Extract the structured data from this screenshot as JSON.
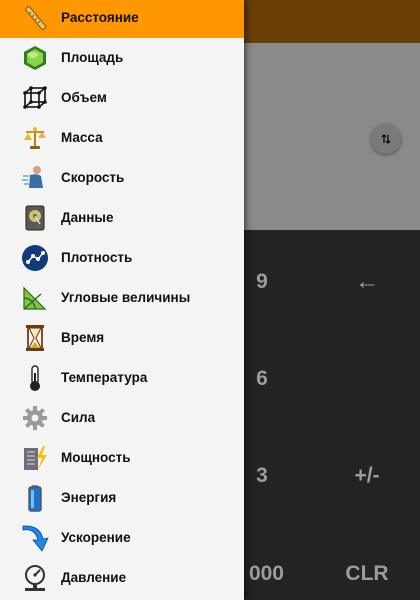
{
  "colors": {
    "accent": "#ff9800",
    "appbar": "#6a3f06",
    "display": "#8a8a8a",
    "keypad": "#232323",
    "drawer_bg": "#f4f4f4",
    "key_text": "#9c9c9c"
  },
  "drawer": {
    "selected": "Расстояние",
    "items": [
      {
        "label": "Расстояние",
        "icon": "ruler-icon"
      },
      {
        "label": "Площадь",
        "icon": "area-hexagon-icon"
      },
      {
        "label": "Объем",
        "icon": "volume-cube-icon"
      },
      {
        "label": "Масса",
        "icon": "scales-icon"
      },
      {
        "label": "Скорость",
        "icon": "runner-icon"
      },
      {
        "label": "Данные",
        "icon": "hard-drive-icon"
      },
      {
        "label": "Плотность",
        "icon": "density-molecule-icon"
      },
      {
        "label": "Угловые величины",
        "icon": "protractor-icon"
      },
      {
        "label": "Время",
        "icon": "hourglass-icon"
      },
      {
        "label": "Температура",
        "icon": "thermometer-icon"
      },
      {
        "label": "Сила",
        "icon": "gear-icon"
      },
      {
        "label": "Мощность",
        "icon": "power-lightning-icon"
      },
      {
        "label": "Энергия",
        "icon": "battery-icon"
      },
      {
        "label": "Ускорение",
        "icon": "curved-arrow-icon"
      },
      {
        "label": "Давление",
        "icon": "pressure-gauge-icon"
      }
    ]
  },
  "swap_button": {
    "icon": "swap-vertical-icon"
  },
  "keypad": {
    "keys": [
      {
        "label": "9"
      },
      {
        "label": "←"
      },
      {
        "label": "6"
      },
      {
        "label": "3"
      },
      {
        "label": "+/-"
      },
      {
        "label": "000"
      },
      {
        "label": "CLR"
      }
    ]
  }
}
